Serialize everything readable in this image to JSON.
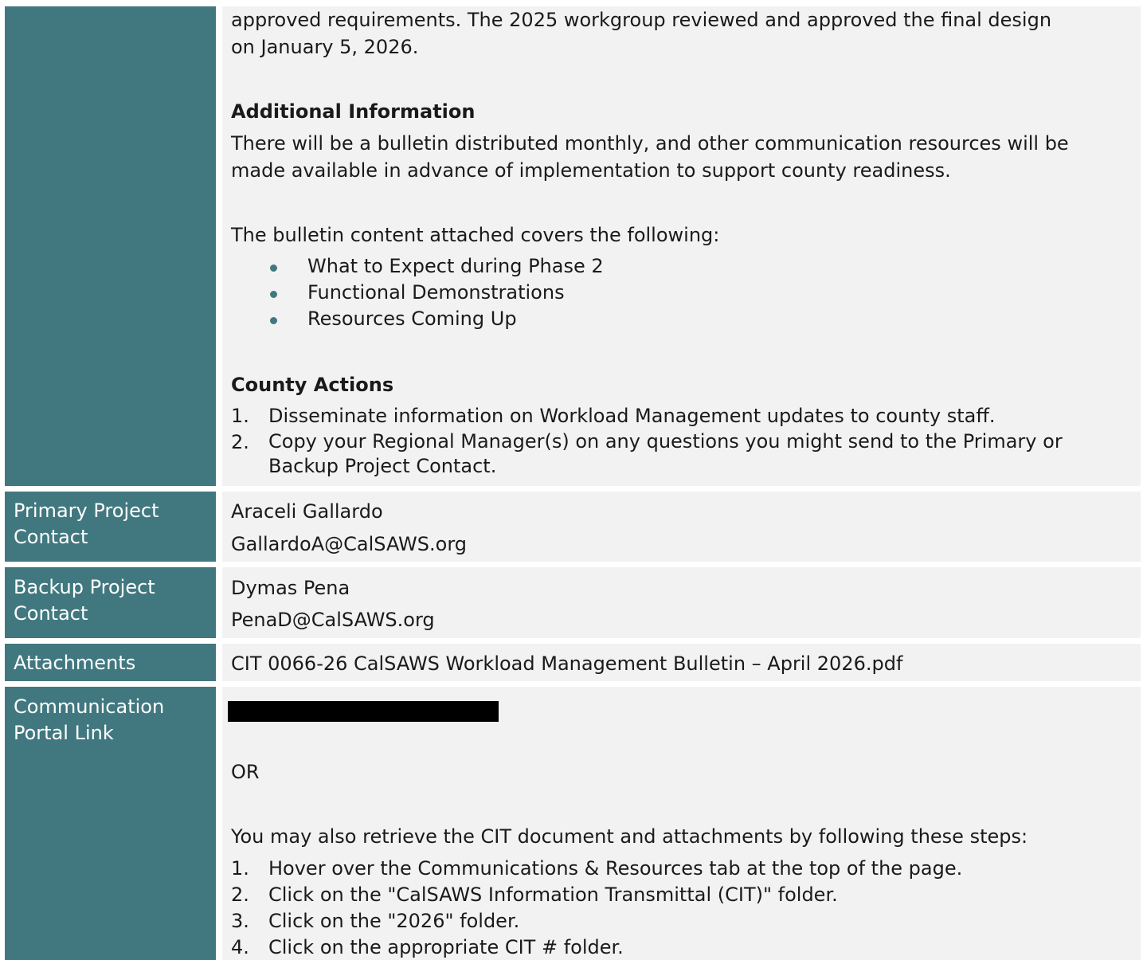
{
  "sections": {
    "details": {
      "intro_lines": [
        "approved requirements. The 2025 workgroup reviewed and approved the final design",
        "on January 5, 2026."
      ],
      "additional_info": {
        "heading": "Additional Information",
        "lines": [
          "There will be a bulletin distributed monthly, and other communication resources will be",
          "made available in advance of implementation to support county readiness."
        ]
      },
      "bulletin_intro": "The bulletin content attached covers the following:",
      "bullets": [
        "What to Expect during Phase 2",
        "Functional Demonstrations",
        "Resources Coming Up"
      ],
      "county_actions": {
        "heading": "County Actions",
        "items": [
          {
            "num": "1.",
            "lines": [
              "Disseminate information on Workload Management updates to county staff."
            ]
          },
          {
            "num": "2.",
            "lines": [
              "Copy your Regional Manager(s) on any questions you might send to the Primary or",
              "Backup Project Contact."
            ]
          }
        ]
      }
    },
    "primary_contact": {
      "label_lines": [
        "Primary Project",
        "Contact"
      ],
      "name": "Araceli Gallardo",
      "email": "GallardoA@CalSAWS.org"
    },
    "backup_contact": {
      "label_lines": [
        "Backup Project",
        "Contact"
      ],
      "name": "Dymas Pena",
      "email": "PenaD@CalSAWS.org"
    },
    "attachments": {
      "label": "Attachments",
      "file": "CIT 0066-26 CalSAWS Workload Management Bulletin – April 2026.pdf"
    },
    "portal": {
      "label_lines": [
        "Communication",
        "Portal Link"
      ],
      "or_text": "OR",
      "steps_intro": "You may also retrieve the CIT document and attachments by following these steps:",
      "steps": [
        {
          "num": "1.",
          "text": "Hover over the Communications & Resources tab at the top of the page."
        },
        {
          "num": "2.",
          "text": "Click on the \"CalSAWS Information Transmittal (CIT)\" folder."
        },
        {
          "num": "3.",
          "text": "Click on the \"2026\" folder."
        },
        {
          "num": "4.",
          "text": "Click on the appropriate CIT # folder."
        }
      ]
    }
  },
  "colors": {
    "label_background": "#417880",
    "content_background": "#f2f2f2",
    "bullet": "#417880"
  }
}
